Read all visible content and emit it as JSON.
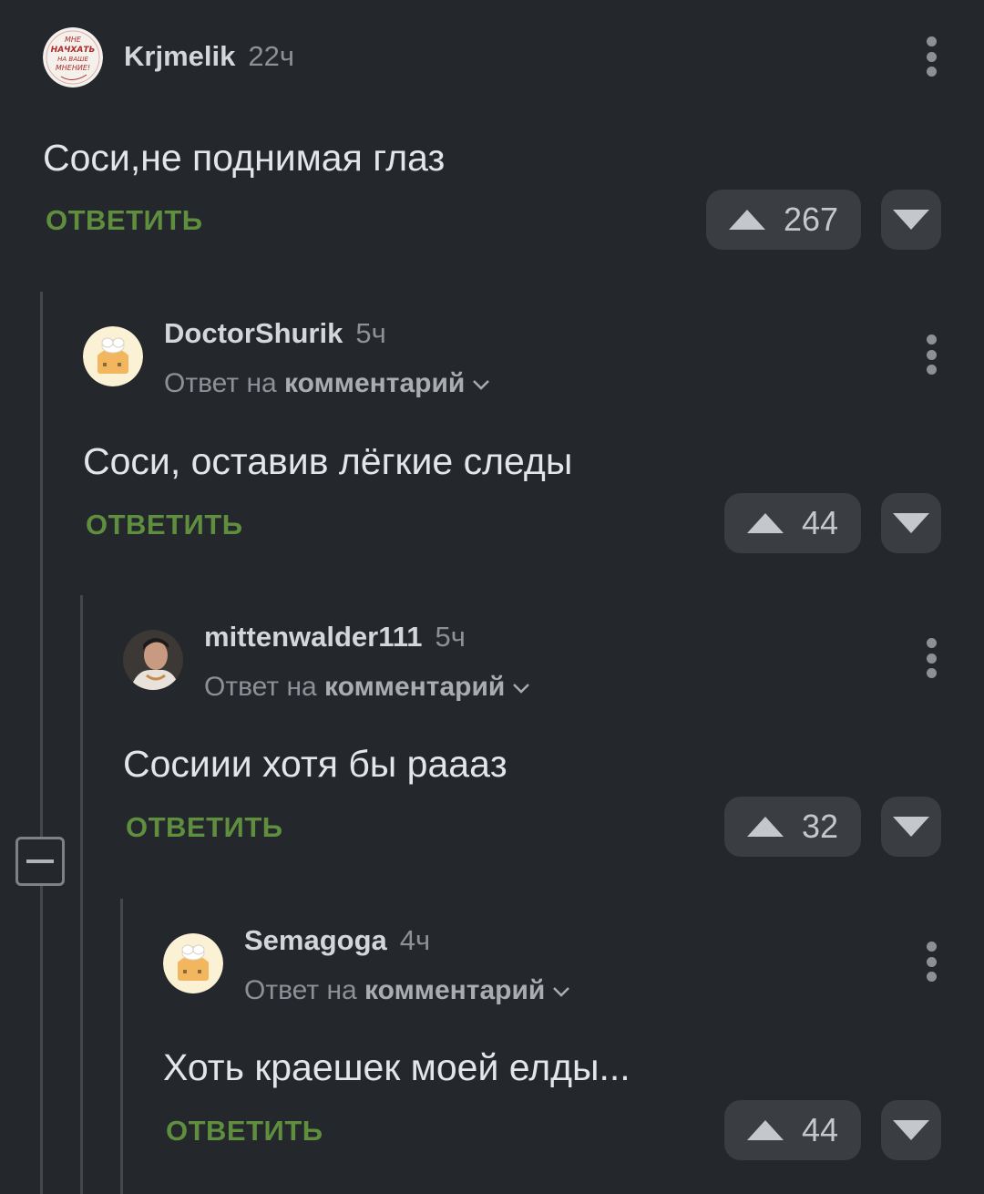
{
  "comments": [
    {
      "author": "Krjmelik",
      "time": "22ч",
      "text": "Соси,не поднимая глаз",
      "reply_label": "ОТВЕТИТЬ",
      "rating": "267",
      "avatar_icon": "stamp-avatar",
      "avatar_text": [
        "МНЕ",
        "НАЧХАТЬ",
        "НА ВАШЕ",
        "МНЕНИЕ!"
      ]
    },
    {
      "author": "DoctorShurik",
      "time": "5ч",
      "reply_prefix": "Ответ на",
      "reply_target": "комментарий",
      "text": "Соси, оставив лёгкие следы",
      "reply_label": "ОТВЕТИТЬ",
      "rating": "44",
      "avatar_icon": "default-bun-avatar"
    },
    {
      "author": "mittenwalder111",
      "time": "5ч",
      "reply_prefix": "Ответ на",
      "reply_target": "комментарий",
      "text": "Сосиии хотя бы рааaз",
      "reply_label": "ОТВЕТИТЬ",
      "rating": "32",
      "avatar_icon": "photo-avatar"
    },
    {
      "author": "Semagoga",
      "time": "4ч",
      "reply_prefix": "Ответ на",
      "reply_target": "комментарий",
      "text": "Хоть краешек моей елды...",
      "reply_label": "ОТВЕТИТЬ",
      "rating": "44",
      "avatar_icon": "default-bun-avatar"
    }
  ],
  "colors": {
    "background": "#24272b",
    "reply_green": "#5f8f3e",
    "button_bg": "#3a3d42"
  }
}
